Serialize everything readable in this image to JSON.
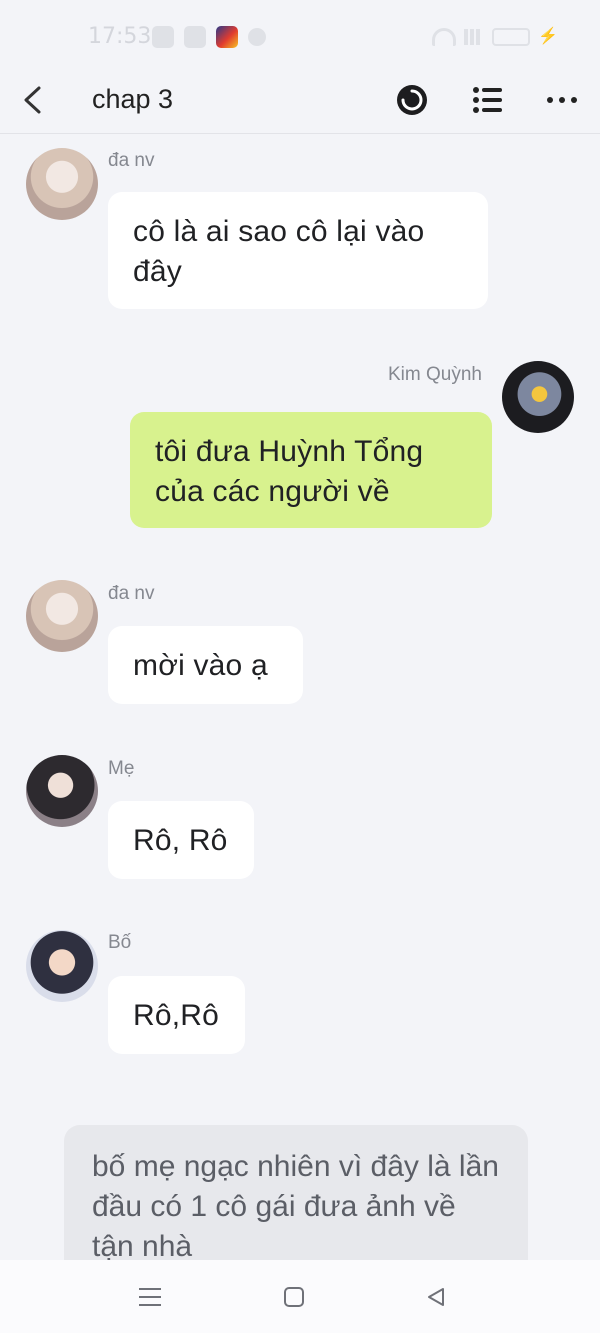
{
  "status_bar": {
    "time": "17:53"
  },
  "topbar": {
    "title": "chap 3"
  },
  "messages": [
    {
      "sender": "đa nv",
      "text": "cô là ai sao cô lại vào đây"
    },
    {
      "sender": "Kim Quỳnh",
      "text": "tôi đưa Huỳnh Tổng của các người về"
    },
    {
      "sender": "đa nv",
      "text": "mời vào ạ"
    },
    {
      "sender": "Mẹ",
      "text": "Rô, Rô"
    },
    {
      "sender": "Bố",
      "text": "Rô,Rô"
    }
  ],
  "narration": {
    "text": "bố mẹ ngạc nhiên vì đây là lần đầu có 1 cô gái đưa ảnh về tận nhà"
  },
  "colors": {
    "outgoing_bubble": "#d8f28e",
    "incoming_bubble": "#ffffff",
    "background": "#f3f4f8"
  },
  "icons": [
    "back-arrow-icon",
    "timer-icon",
    "list-icon",
    "more-icon",
    "menu-icon",
    "home-icon",
    "back-nav-icon"
  ]
}
